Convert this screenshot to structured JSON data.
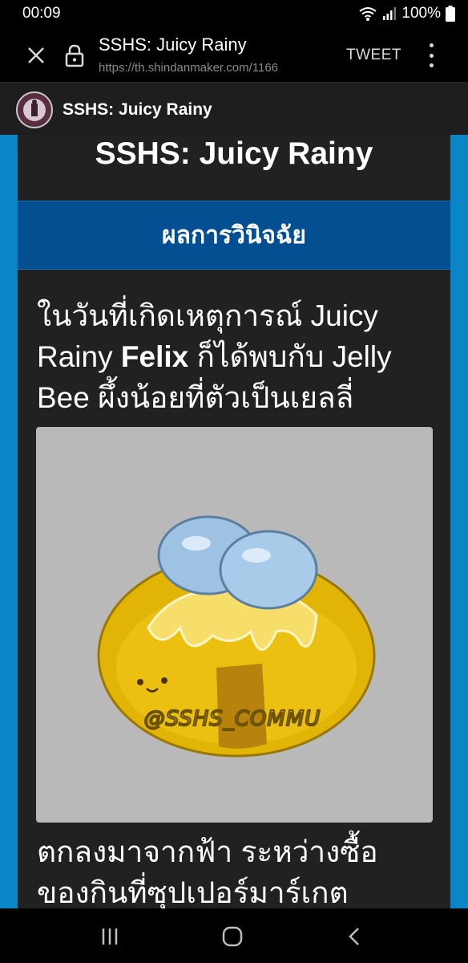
{
  "status": {
    "time": "00:09",
    "battery": "100%",
    "icons": [
      "wifi-icon",
      "signal-icon",
      "battery-icon"
    ]
  },
  "browser": {
    "page_title": "SSHS: Juicy Rainy",
    "url": "https://th.shindanmaker.com/1166",
    "tweet_label": "TWEET",
    "icons": [
      "close-icon",
      "lock-icon",
      "more-vert-icon"
    ]
  },
  "site": {
    "name": "SSHS: Juicy Rainy"
  },
  "main": {
    "title": "SSHS: Juicy Rainy",
    "result_heading": "ผลการวินิจฉัย",
    "result_line_1": "ในวันที่เกิดเหตุการณ์ Juicy Rainy ",
    "result_name": "Felix",
    "result_line_2": " ก็ได้พบกับ Jelly Bee ผึ้งน้อยที่ตัวเป็นเยลลี่",
    "image_watermark": "@SSHS_COMMU",
    "result_line_3": " ตกลงมาจากฟ้า ระหว่างซื้อของกินที่ซุปเปอร์มาร์เกต"
  },
  "nav": {
    "icons": [
      "recent-apps-icon",
      "home-icon",
      "back-icon"
    ]
  },
  "colors": {
    "page_background": "#0a86c6",
    "card_background": "#212121",
    "result_header": "#034f92",
    "image_background": "#b9b9b9"
  }
}
